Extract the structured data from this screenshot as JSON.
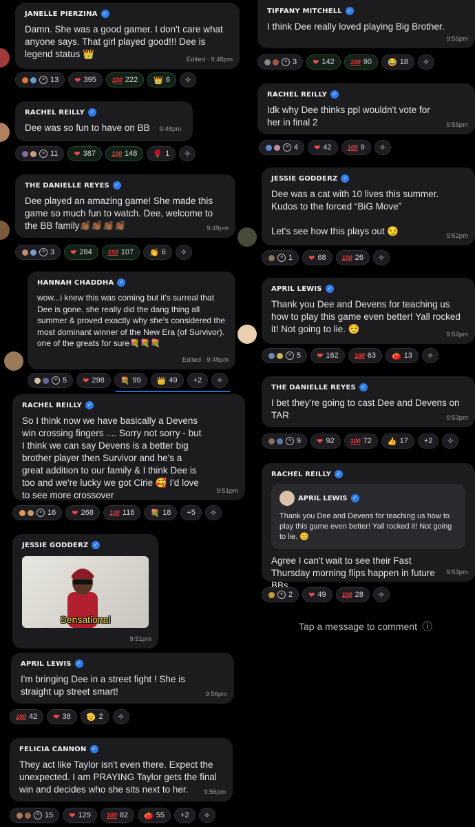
{
  "left": [
    {
      "name": "JANELLE PIERZINA",
      "text": "Damn. She was a good gamer. I don't care what anyone says. That girl played good!!! Dee is legend status 👑",
      "meta": "Edited · 9:48pm",
      "reactions": {
        "thread": "13",
        "heart": "395",
        "hundred": "222",
        "extra_emoji": "👑",
        "extra": "6"
      }
    },
    {
      "name": "RACHEL REILLY",
      "text": "Dee was so fun to have on BB",
      "meta": "9:48pm",
      "reactions": {
        "thread": "11",
        "heart": "387",
        "hundred": "148",
        "extra_emoji": "🌹",
        "extra": "1"
      }
    },
    {
      "name": "THE DANIELLE REYES",
      "text": "Dee played an amazing game! She made this game so much fun to watch. Dee, welcome to the BB family👏🏾👏🏾👏🏾👏🏾",
      "meta": "9:49pm",
      "reactions": {
        "thread": "3",
        "heart": "284",
        "hundred": "107",
        "extra_emoji": "👏",
        "extra": "6"
      }
    },
    {
      "name": "HANNAH CHADDHA",
      "text": "wow...i knew this was coming but it's surreal that Dee is gone. she really did the dang thing all summer & proved exactly why she's considered the most dominant winner of the New Era (of Survivor). one of the greats for sure💐💐💐",
      "meta": "Edited · 9:49pm",
      "reactions": {
        "thread": "5",
        "heart": "298",
        "extra_emoji": "💐",
        "extra": "99",
        "extra2_emoji": "👑",
        "extra2": "49",
        "more": "+2"
      }
    },
    {
      "name": "RACHEL REILLY",
      "text": "So I think now we have basically a Devens win crossing fingers .... Sorry not sorry - but I think we can say Devens is a better big brother player then Survivor and he's a great addition to our family & I think Dee is too and we're lucky we got Cirie 🥰 I'd love to see more crossover",
      "meta": "9:51pm",
      "reactions": {
        "thread": "16",
        "heart": "268",
        "hundred": "116",
        "extra_emoji": "💐",
        "extra": "18",
        "more": "+5"
      }
    },
    {
      "name": "JESSIE GODDERZ",
      "gif_caption": "Sensational",
      "meta": "9:51pm"
    },
    {
      "name": "APRIL LEWIS",
      "text": "I'm bringing Dee in a street fight ! She is straight up street smart!",
      "meta": "9:56pm",
      "reactions": {
        "hundred": "42",
        "heart": "38",
        "extra_emoji": "🫡",
        "extra": "2"
      }
    },
    {
      "name": "FELICIA CANNON",
      "text": "They act like Taylor isn't even there. Expect the unexpected. I am PRAYING Taylor gets the final win and decides who she sits next to her.",
      "meta": "9:56pm",
      "reactions": {
        "thread": "15",
        "heart": "129",
        "hundred": "82",
        "extra_emoji": "🍅",
        "extra": "55",
        "more": "+2"
      }
    }
  ],
  "right": [
    {
      "name": "TIFFANY MITCHELL",
      "text": "I think Dee really loved playing Big Brother.",
      "meta": "9:55pm",
      "reactions": {
        "thread": "3",
        "heart": "142",
        "hundred": "90",
        "extra_emoji": "😂",
        "extra": "18"
      }
    },
    {
      "name": "RACHEL REILLY",
      "text": "Idk why Dee thinks ppl wouldn't vote for her in final 2",
      "meta": "9:55pm",
      "reactions": {
        "thread": "4",
        "heart": "42",
        "hundred": "9"
      }
    },
    {
      "name": "JESSIE GODDERZ",
      "text": "Dee was a cat with 10 lives this summer. Kudos to the forced “BiG Move”\n\nLet's see how this plays out 😏",
      "meta": "9:52pm",
      "reactions": {
        "thread": "1",
        "heart": "68",
        "hundred": "26"
      }
    },
    {
      "name": "APRIL LEWIS",
      "text": "Thank you Dee and Devens for teaching us how to play this game even better! Yall rocked it! Not going to lie. ☺️",
      "meta": "9:52pm",
      "reactions": {
        "thread": "5",
        "heart": "162",
        "hundred": "63",
        "extra_emoji": "🍅",
        "extra": "13"
      }
    },
    {
      "name": "THE DANIELLE REYES",
      "text": "I bet they're going to cast Dee and Devens on TAR",
      "meta": "9:53pm",
      "reactions": {
        "thread": "9",
        "heart": "92",
        "hundred": "72",
        "extra_emoji": "👍",
        "extra": "17",
        "more": "+2"
      }
    },
    {
      "name": "RACHEL REILLY",
      "quote_name": "APRIL LEWIS",
      "quote_text": "Thank you Dee and Devens for teaching us how to play this game even better! Yall rocked it! Not going to lie. 😊",
      "text": "Agree I can't wait to see their Fast Thursday morning flips happen in future BBs",
      "meta": "9:53pm",
      "reactions": {
        "thread": "2",
        "heart": "49",
        "hundred": "28"
      }
    }
  ],
  "composer": {
    "placeholder": "Tap a message to comment",
    "info_icon": "ⓘ"
  },
  "icons": {
    "hundred": "100",
    "heart": "❤",
    "spark": "✧",
    "thread": "≡",
    "verified": "✓"
  },
  "colors": {
    "bubble": "#1c1c1f",
    "verified": "#2f7bf0",
    "heart": "#f04a4a",
    "hundred": "#f03b3b",
    "accent_line": "#2c6fd6"
  }
}
